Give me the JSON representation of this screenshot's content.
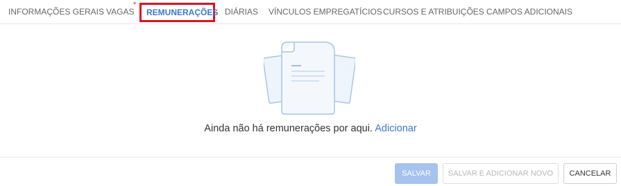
{
  "tabs": [
    {
      "label": "INFORMAÇÕES GERAIS"
    },
    {
      "label": "VAGAS",
      "required_marker": "*"
    },
    {
      "label": "REMUNERAÇÕES",
      "active": true
    },
    {
      "label": "DIÁRIAS"
    },
    {
      "label": "VÍNCULOS EMPREGATÍCIOS"
    },
    {
      "label": "CURSOS E ATRIBUIÇÕES"
    },
    {
      "label": "CAMPOS ADICIONAIS"
    }
  ],
  "empty_state": {
    "icon": "documents-icon",
    "message": "Ainda não há remunerações por aqui.",
    "action_label": "Adicionar"
  },
  "footer": {
    "save_label": "SALVAR",
    "save_and_new_label": "SALVAR E ADICIONAR NOVO",
    "cancel_label": "CANCELAR"
  },
  "colors": {
    "accent": "#3b79cc",
    "highlight_border": "#e0101e",
    "required": "#d9302f",
    "primary_button_disabled": "#a6c3ee"
  }
}
